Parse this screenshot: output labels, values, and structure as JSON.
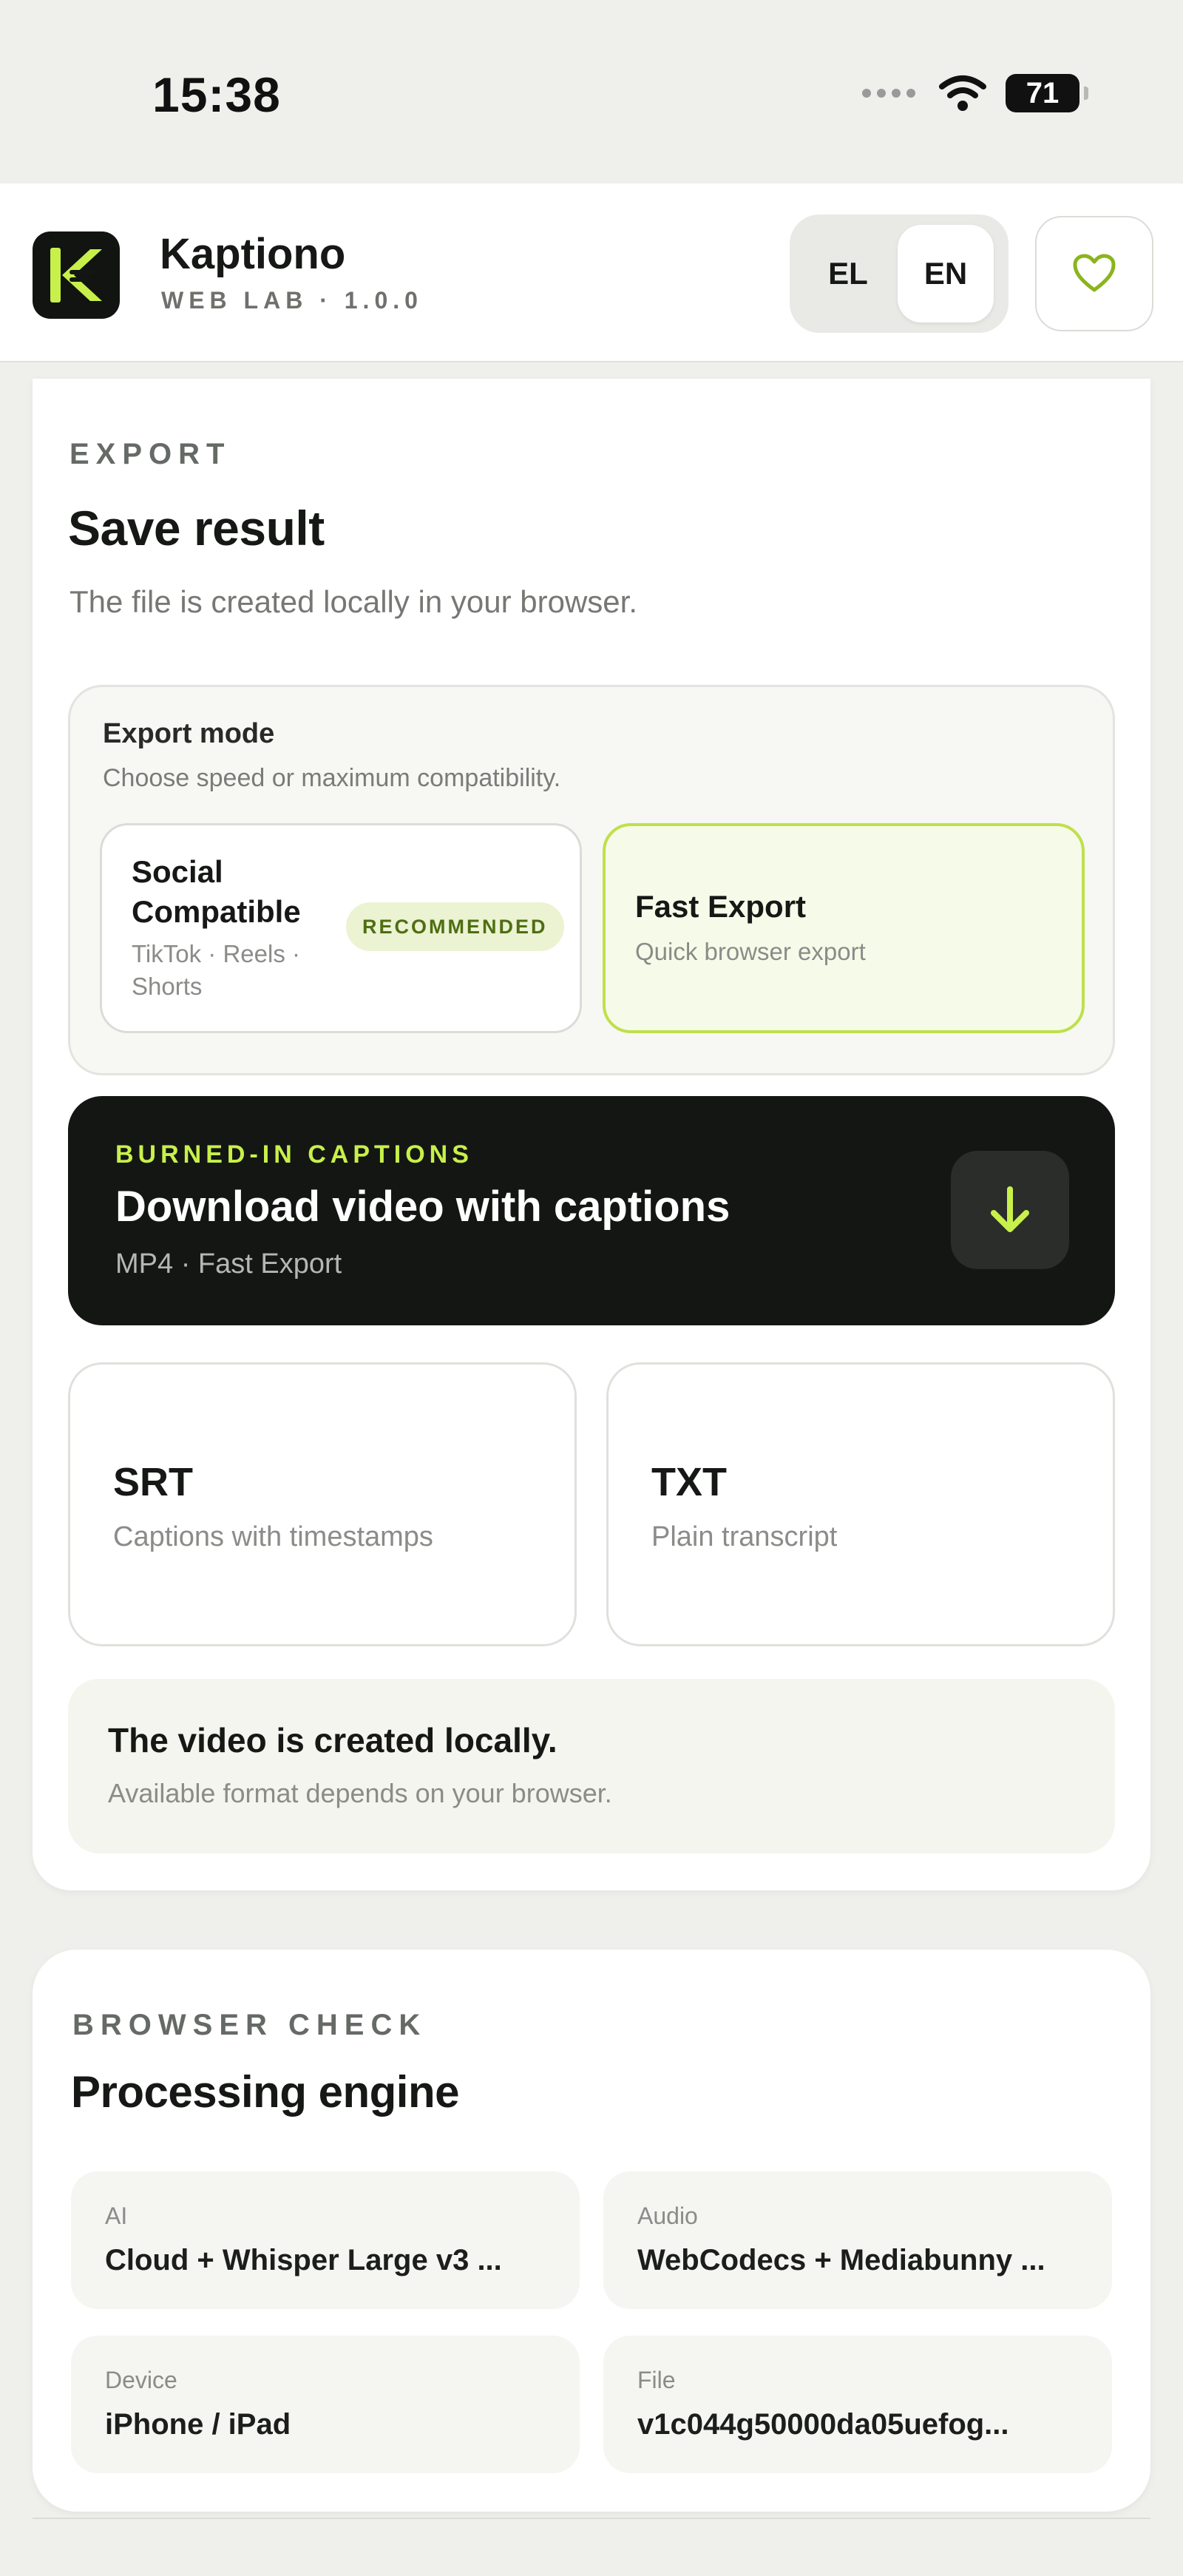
{
  "status": {
    "time": "15:38",
    "battery": "71"
  },
  "app": {
    "name": "Kaptiono",
    "subtitle": "WEB LAB · 1.0.0"
  },
  "lang": {
    "el": "EL",
    "en": "EN",
    "active": "EN"
  },
  "export": {
    "eyebrow": "EXPORT",
    "title": "Save result",
    "desc": "The file is created locally in your browser.",
    "mode": {
      "title": "Export mode",
      "sub": "Choose speed or maximum compatibility.",
      "options": [
        {
          "line1": "Social",
          "line2": "Compatible",
          "sub1": "TikTok · Reels ·",
          "sub2": "Shorts",
          "badge": "RECOMMENDED"
        },
        {
          "title": "Fast Export",
          "sub": "Quick browser export",
          "selected": true
        }
      ]
    },
    "download": {
      "eyebrow": "BURNED-IN CAPTIONS",
      "title": "Download video with captions",
      "sub": "MP4 · Fast Export"
    },
    "formats": [
      {
        "title": "SRT",
        "sub": "Captions with timestamps"
      },
      {
        "title": "TXT",
        "sub": "Plain transcript"
      }
    ],
    "note": {
      "title": "The video is created locally.",
      "sub": "Available format depends on your browser."
    }
  },
  "browser": {
    "eyebrow": "BROWSER CHECK",
    "title": "Processing engine",
    "tiles": [
      {
        "label": "AI",
        "value": "Cloud + Whisper Large v3 ..."
      },
      {
        "label": "Audio",
        "value": "WebCodecs + Mediabunny ..."
      },
      {
        "label": "Device",
        "value": "iPhone / iPad"
      },
      {
        "label": "File",
        "value": "v1c044g50000da05uefog..."
      }
    ]
  },
  "colors": {
    "accent": "#bfe04a",
    "accent_text": "#c8f04a",
    "dark": "#141614"
  }
}
